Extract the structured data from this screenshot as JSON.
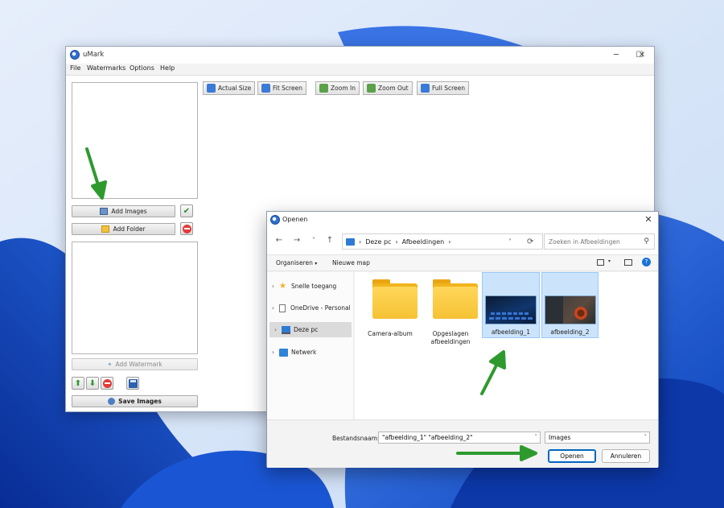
{
  "umark": {
    "title": "uMark",
    "controls": {
      "minimize": "─",
      "maximize": "☐",
      "close": "✕"
    },
    "menu": [
      "File",
      "Watermarks",
      "Options",
      "Help"
    ],
    "add_images_label": "Add Images",
    "add_folder_label": "Add Folder",
    "add_watermark_label": "Add Watermark",
    "save_images_label": "Save Images",
    "toolbar": [
      "Actual Size",
      "Fit Screen",
      "Zoom In",
      "Zoom Out",
      "Full Screen"
    ]
  },
  "dialog": {
    "title": "Openen",
    "close": "✕",
    "nav": {
      "back": "←",
      "forward": "→",
      "dropdown": "˅",
      "up": "↑",
      "refresh": "⟳"
    },
    "breadcrumb": [
      "Deze pc",
      "Afbeeldingen"
    ],
    "search_placeholder": "Zoeken in Afbeeldingen",
    "commands": {
      "organize": "Organiseren",
      "new_folder": "Nieuwe map"
    },
    "nav_pane": [
      {
        "label": "Snelle toegang",
        "icon": "star-icon"
      },
      {
        "label": "OneDrive - Personal",
        "icon": "document-icon"
      },
      {
        "label": "Deze pc",
        "icon": "computer-icon",
        "selected": true
      },
      {
        "label": "Netwerk",
        "icon": "network-icon"
      }
    ],
    "items": [
      {
        "label": "Camera-album",
        "type": "folder"
      },
      {
        "label": "Opgeslagen afbeeldingen",
        "type": "folder"
      },
      {
        "label": "afbeelding_1",
        "type": "image",
        "selected": true
      },
      {
        "label": "afbeelding_2",
        "type": "image",
        "selected": true
      }
    ],
    "filename_label": "Bestandsnaam:",
    "filename_value": "\"afbeelding_1\" \"afbeelding_2\"",
    "filetype_value": "Images",
    "open_label": "Openen",
    "cancel_label": "Annuleren"
  },
  "colors": {
    "accent": "#0067c0",
    "arrow": "#2e9a2e",
    "folder": "#f6c234",
    "selection": "#cce4fb"
  }
}
